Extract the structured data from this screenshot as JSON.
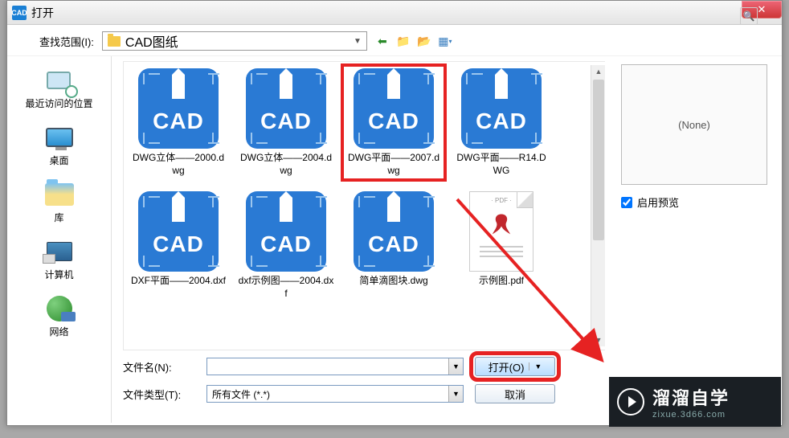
{
  "title": "打开",
  "lookin_label": "查找范围(I):",
  "lookin_value": "CAD图纸",
  "toolbar_icons": [
    "back-icon",
    "up-icon",
    "new-folder-icon",
    "views-icon",
    "tools-icon"
  ],
  "sidebar": {
    "items": [
      {
        "label": "最近访问的位置",
        "icon": "recent"
      },
      {
        "label": "桌面",
        "icon": "desktop"
      },
      {
        "label": "库",
        "icon": "library"
      },
      {
        "label": "计算机",
        "icon": "computer"
      },
      {
        "label": "网络",
        "icon": "network"
      }
    ]
  },
  "files": [
    {
      "name": "DWG立体——2000.dwg",
      "type": "cad"
    },
    {
      "name": "DWG立体——2004.dwg",
      "type": "cad"
    },
    {
      "name": "DWG平面——2007.dwg",
      "type": "cad",
      "highlighted": true
    },
    {
      "name": "DWG平面——R14.DWG",
      "type": "cad"
    },
    {
      "name": "DXF平面——2004.dxf",
      "type": "cad"
    },
    {
      "name": "dxf示例图——2004.dxf",
      "type": "cad"
    },
    {
      "name": "简单滴图块.dwg",
      "type": "cad"
    },
    {
      "name": "示例图.pdf",
      "type": "pdf"
    }
  ],
  "pdf_tag": "PDF",
  "cad_text": "CAD",
  "form": {
    "name_label": "文件名(N):",
    "name_value": "",
    "type_label": "文件类型(T):",
    "type_value": "所有文件 (*.*)"
  },
  "buttons": {
    "open": "打开(O)",
    "cancel": "取消"
  },
  "preview": {
    "none": "(None)",
    "enable": "启用预览"
  },
  "watermark": {
    "main": "溜溜自学",
    "sub": "zixue.3d66.com"
  },
  "colors": {
    "highlight": "#e62222",
    "cad_blue": "#2a7ad4"
  }
}
